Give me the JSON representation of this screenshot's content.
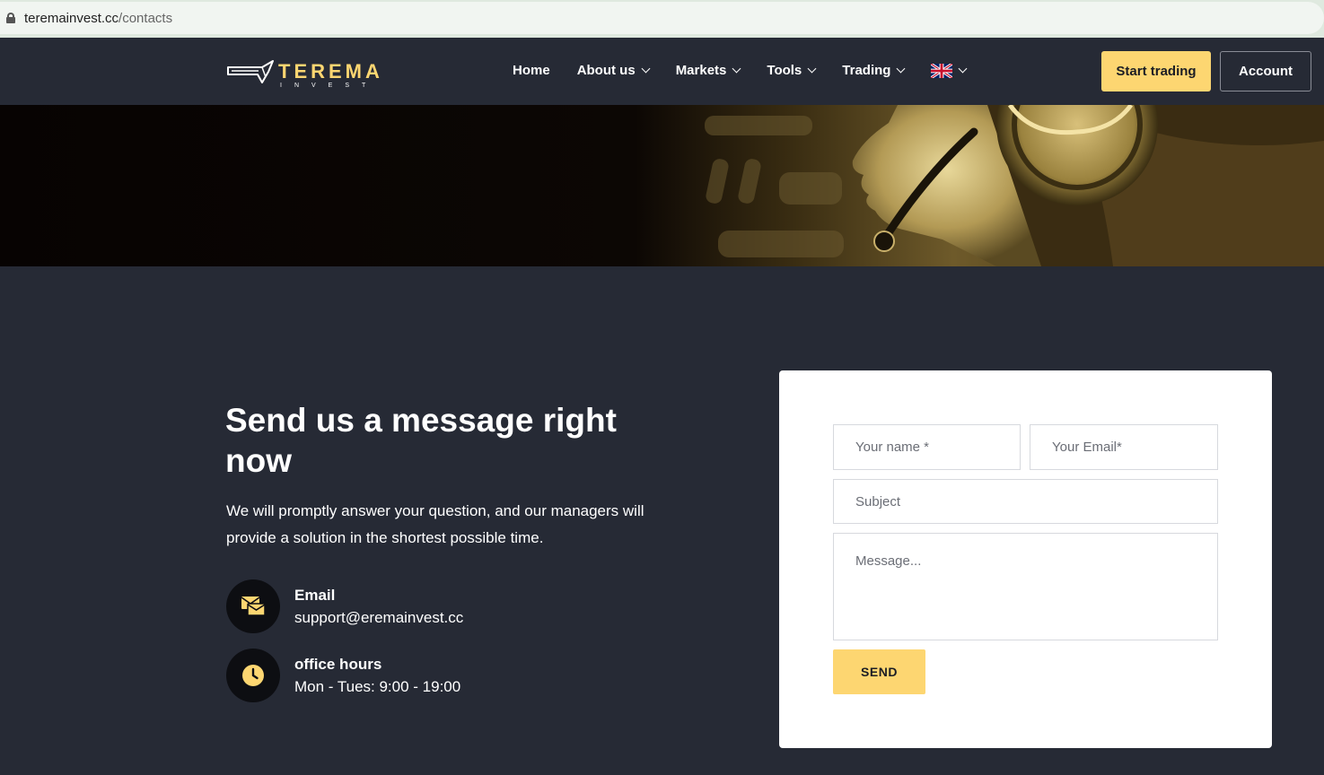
{
  "browser": {
    "url_domain": "teremainvest.cc",
    "url_path": "/contacts"
  },
  "nav": {
    "logo_text": "TEREMA",
    "logo_subtext": "INVEST",
    "items": [
      {
        "label": "Home",
        "dropdown": false
      },
      {
        "label": "About us",
        "dropdown": true
      },
      {
        "label": "Markets",
        "dropdown": true
      },
      {
        "label": "Tools",
        "dropdown": true
      },
      {
        "label": "Trading",
        "dropdown": true
      }
    ],
    "language_icon": "uk-flag-icon",
    "start_trading_label": "Start trading",
    "account_label": "Account"
  },
  "contact": {
    "heading": "Send us a message right now",
    "description": "We will promptly answer your question, and our managers will provide a solution in the shortest possible time.",
    "email": {
      "title": "Email",
      "value": "support@eremainvest.cc",
      "icon": "envelope-icon"
    },
    "hours": {
      "title": "office hours",
      "value": "Mon - Tues: 9:00 - 19:00",
      "icon": "clock-icon"
    }
  },
  "form": {
    "name_placeholder": "Your name *",
    "email_placeholder": "Your Email*",
    "subject_placeholder": "Subject",
    "message_placeholder": "Message...",
    "send_label": "SEND"
  },
  "colors": {
    "accent": "#fdd671",
    "background": "#262a35",
    "card": "#ffffff"
  }
}
